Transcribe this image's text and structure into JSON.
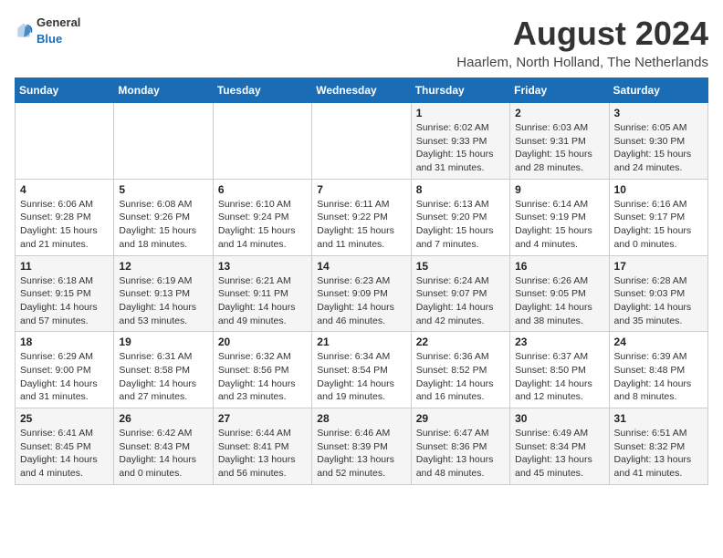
{
  "header": {
    "logo": {
      "general": "General",
      "blue": "Blue"
    },
    "month_year": "August 2024",
    "location": "Haarlem, North Holland, The Netherlands"
  },
  "weekdays": [
    "Sunday",
    "Monday",
    "Tuesday",
    "Wednesday",
    "Thursday",
    "Friday",
    "Saturday"
  ],
  "weeks": [
    [
      {
        "day": "",
        "info": ""
      },
      {
        "day": "",
        "info": ""
      },
      {
        "day": "",
        "info": ""
      },
      {
        "day": "",
        "info": ""
      },
      {
        "day": "1",
        "info": "Sunrise: 6:02 AM\nSunset: 9:33 PM\nDaylight: 15 hours\nand 31 minutes."
      },
      {
        "day": "2",
        "info": "Sunrise: 6:03 AM\nSunset: 9:31 PM\nDaylight: 15 hours\nand 28 minutes."
      },
      {
        "day": "3",
        "info": "Sunrise: 6:05 AM\nSunset: 9:30 PM\nDaylight: 15 hours\nand 24 minutes."
      }
    ],
    [
      {
        "day": "4",
        "info": "Sunrise: 6:06 AM\nSunset: 9:28 PM\nDaylight: 15 hours\nand 21 minutes."
      },
      {
        "day": "5",
        "info": "Sunrise: 6:08 AM\nSunset: 9:26 PM\nDaylight: 15 hours\nand 18 minutes."
      },
      {
        "day": "6",
        "info": "Sunrise: 6:10 AM\nSunset: 9:24 PM\nDaylight: 15 hours\nand 14 minutes."
      },
      {
        "day": "7",
        "info": "Sunrise: 6:11 AM\nSunset: 9:22 PM\nDaylight: 15 hours\nand 11 minutes."
      },
      {
        "day": "8",
        "info": "Sunrise: 6:13 AM\nSunset: 9:20 PM\nDaylight: 15 hours\nand 7 minutes."
      },
      {
        "day": "9",
        "info": "Sunrise: 6:14 AM\nSunset: 9:19 PM\nDaylight: 15 hours\nand 4 minutes."
      },
      {
        "day": "10",
        "info": "Sunrise: 6:16 AM\nSunset: 9:17 PM\nDaylight: 15 hours\nand 0 minutes."
      }
    ],
    [
      {
        "day": "11",
        "info": "Sunrise: 6:18 AM\nSunset: 9:15 PM\nDaylight: 14 hours\nand 57 minutes."
      },
      {
        "day": "12",
        "info": "Sunrise: 6:19 AM\nSunset: 9:13 PM\nDaylight: 14 hours\nand 53 minutes."
      },
      {
        "day": "13",
        "info": "Sunrise: 6:21 AM\nSunset: 9:11 PM\nDaylight: 14 hours\nand 49 minutes."
      },
      {
        "day": "14",
        "info": "Sunrise: 6:23 AM\nSunset: 9:09 PM\nDaylight: 14 hours\nand 46 minutes."
      },
      {
        "day": "15",
        "info": "Sunrise: 6:24 AM\nSunset: 9:07 PM\nDaylight: 14 hours\nand 42 minutes."
      },
      {
        "day": "16",
        "info": "Sunrise: 6:26 AM\nSunset: 9:05 PM\nDaylight: 14 hours\nand 38 minutes."
      },
      {
        "day": "17",
        "info": "Sunrise: 6:28 AM\nSunset: 9:03 PM\nDaylight: 14 hours\nand 35 minutes."
      }
    ],
    [
      {
        "day": "18",
        "info": "Sunrise: 6:29 AM\nSunset: 9:00 PM\nDaylight: 14 hours\nand 31 minutes."
      },
      {
        "day": "19",
        "info": "Sunrise: 6:31 AM\nSunset: 8:58 PM\nDaylight: 14 hours\nand 27 minutes."
      },
      {
        "day": "20",
        "info": "Sunrise: 6:32 AM\nSunset: 8:56 PM\nDaylight: 14 hours\nand 23 minutes."
      },
      {
        "day": "21",
        "info": "Sunrise: 6:34 AM\nSunset: 8:54 PM\nDaylight: 14 hours\nand 19 minutes."
      },
      {
        "day": "22",
        "info": "Sunrise: 6:36 AM\nSunset: 8:52 PM\nDaylight: 14 hours\nand 16 minutes."
      },
      {
        "day": "23",
        "info": "Sunrise: 6:37 AM\nSunset: 8:50 PM\nDaylight: 14 hours\nand 12 minutes."
      },
      {
        "day": "24",
        "info": "Sunrise: 6:39 AM\nSunset: 8:48 PM\nDaylight: 14 hours\nand 8 minutes."
      }
    ],
    [
      {
        "day": "25",
        "info": "Sunrise: 6:41 AM\nSunset: 8:45 PM\nDaylight: 14 hours\nand 4 minutes."
      },
      {
        "day": "26",
        "info": "Sunrise: 6:42 AM\nSunset: 8:43 PM\nDaylight: 14 hours\nand 0 minutes."
      },
      {
        "day": "27",
        "info": "Sunrise: 6:44 AM\nSunset: 8:41 PM\nDaylight: 13 hours\nand 56 minutes."
      },
      {
        "day": "28",
        "info": "Sunrise: 6:46 AM\nSunset: 8:39 PM\nDaylight: 13 hours\nand 52 minutes."
      },
      {
        "day": "29",
        "info": "Sunrise: 6:47 AM\nSunset: 8:36 PM\nDaylight: 13 hours\nand 48 minutes."
      },
      {
        "day": "30",
        "info": "Sunrise: 6:49 AM\nSunset: 8:34 PM\nDaylight: 13 hours\nand 45 minutes."
      },
      {
        "day": "31",
        "info": "Sunrise: 6:51 AM\nSunset: 8:32 PM\nDaylight: 13 hours\nand 41 minutes."
      }
    ]
  ]
}
